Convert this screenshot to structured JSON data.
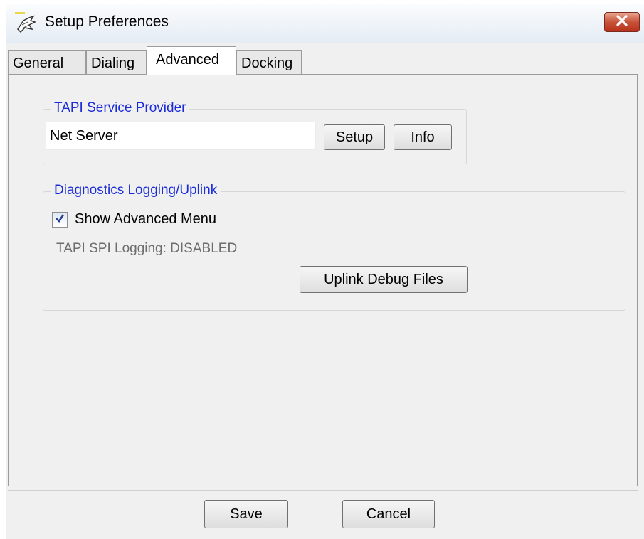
{
  "window": {
    "title": "Setup Preferences",
    "app_icon": "hand-pointer-icon",
    "close_icon": "close-icon"
  },
  "tabs": [
    {
      "label": "General",
      "active": false
    },
    {
      "label": "Dialing",
      "active": false
    },
    {
      "label": "Advanced",
      "active": true
    },
    {
      "label": "Docking",
      "active": false
    }
  ],
  "tapi_group": {
    "legend": "TAPI Service Provider",
    "provider_value": "Net Server",
    "setup_label": "Setup",
    "info_label": "Info"
  },
  "diag_group": {
    "legend": "Diagnostics Logging/Uplink",
    "show_advanced_label": "Show Advanced Menu",
    "show_advanced_checked": true,
    "logging_status": "TAPI SPI Logging: DISABLED",
    "uplink_label": "Uplink Debug Files"
  },
  "footer": {
    "save_label": "Save",
    "cancel_label": "Cancel"
  },
  "colors": {
    "group_legend": "#1a2bd8",
    "close_button": "#c7533a",
    "disabled_text": "#6d6d6d"
  }
}
